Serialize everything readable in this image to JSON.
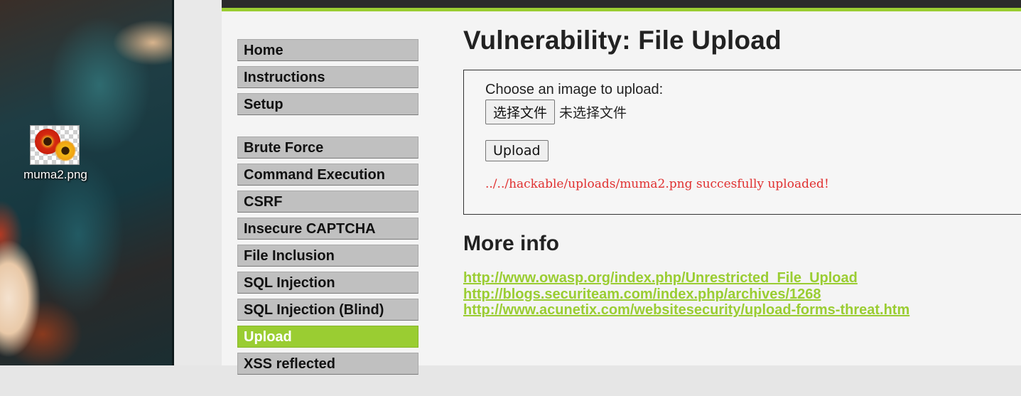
{
  "desktop": {
    "icon_label": "muma2.png",
    "icon_name": "image-file-icon"
  },
  "menu": {
    "group1": [
      {
        "label": "Home"
      },
      {
        "label": "Instructions"
      },
      {
        "label": "Setup"
      }
    ],
    "group2": [
      {
        "label": "Brute Force"
      },
      {
        "label": "Command Execution"
      },
      {
        "label": "CSRF"
      },
      {
        "label": "Insecure CAPTCHA"
      },
      {
        "label": "File Inclusion"
      },
      {
        "label": "SQL Injection"
      },
      {
        "label": "SQL Injection (Blind)"
      },
      {
        "label": "Upload",
        "selected": true
      },
      {
        "label": "XSS reflected"
      }
    ]
  },
  "main": {
    "title": "Vulnerability: File Upload",
    "form": {
      "prompt": "Choose an image to upload:",
      "choose_button": "选择文件",
      "no_file_text": "未选择文件",
      "upload_button": "Upload",
      "result_message": "../../hackable/uploads/muma2.png succesfully uploaded!"
    },
    "more_info_heading": "More info",
    "links": [
      "http://www.owasp.org/index.php/Unrestricted_File_Upload",
      "http://blogs.securiteam.com/index.php/archives/1268",
      "http://www.acunetix.com/websitesecurity/upload-forms-threat.htm"
    ]
  },
  "colors": {
    "accent_green": "#9acd32",
    "header_dark": "#2b2b2b",
    "error_red": "#e03030"
  }
}
